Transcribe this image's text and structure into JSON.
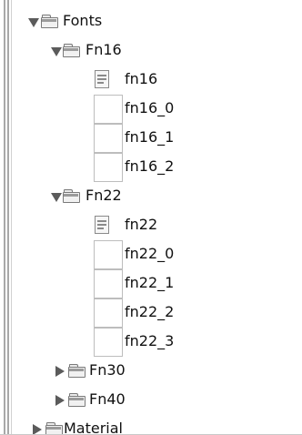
{
  "tree": {
    "fonts": {
      "label": "Fonts"
    },
    "fn16": {
      "label": "Fn16"
    },
    "fn16_doc": {
      "label": "fn16"
    },
    "fn16_0": {
      "label": "fn16_0"
    },
    "fn16_1": {
      "label": "fn16_1"
    },
    "fn16_2": {
      "label": "fn16_2"
    },
    "fn22": {
      "label": "Fn22"
    },
    "fn22_doc": {
      "label": "fn22"
    },
    "fn22_0": {
      "label": "fn22_0"
    },
    "fn22_1": {
      "label": "fn22_1"
    },
    "fn22_2": {
      "label": "fn22_2"
    },
    "fn22_3": {
      "label": "fn22_3"
    },
    "fn30": {
      "label": "Fn30"
    },
    "fn40": {
      "label": "Fn40"
    },
    "material": {
      "label": "Material"
    }
  }
}
